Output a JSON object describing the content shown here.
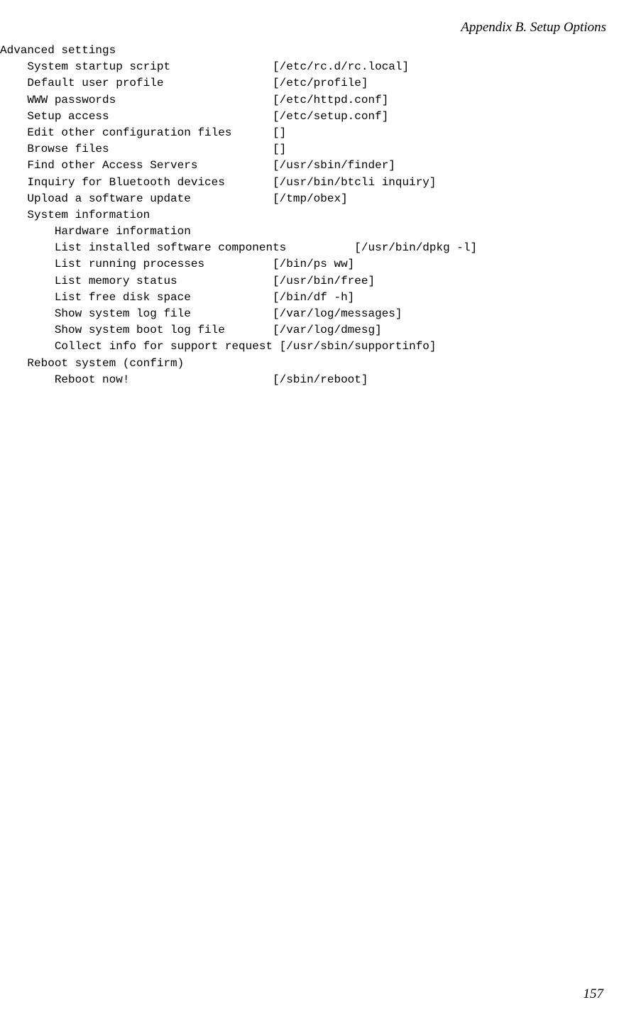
{
  "header": "Appendix B. Setup Options",
  "page_number": "157",
  "lines": [
    {
      "indent": 0,
      "label": "Advanced settings",
      "value": ""
    },
    {
      "indent": 1,
      "label": "System startup script",
      "value": "[/etc/rc.d/rc.local]"
    },
    {
      "indent": 1,
      "label": "Default user profile",
      "value": "[/etc/profile]"
    },
    {
      "indent": 1,
      "label": "WWW passwords",
      "value": "[/etc/httpd.conf]"
    },
    {
      "indent": 1,
      "label": "Setup access",
      "value": "[/etc/setup.conf]"
    },
    {
      "indent": 1,
      "label": "Edit other configuration files",
      "value": "[]"
    },
    {
      "indent": 1,
      "label": "Browse files",
      "value": "[]"
    },
    {
      "indent": 1,
      "label": "Find other Access Servers",
      "value": "[/usr/sbin/finder]"
    },
    {
      "indent": 1,
      "label": "Inquiry for Bluetooth devices",
      "value": "[/usr/bin/btcli inquiry]"
    },
    {
      "indent": 1,
      "label": "Upload a software update",
      "value": "[/tmp/obex]"
    },
    {
      "indent": 1,
      "label": "System information",
      "value": ""
    },
    {
      "indent": 2,
      "label": "Hardware information",
      "value": ""
    },
    {
      "indent": 2,
      "label": "List installed software components",
      "value": "[/usr/bin/dpkg -l]",
      "label_width": 44
    },
    {
      "indent": 2,
      "label": "List running processes",
      "value": "[/bin/ps ww]"
    },
    {
      "indent": 2,
      "label": "List memory status",
      "value": "[/usr/bin/free]"
    },
    {
      "indent": 2,
      "label": "List free disk space",
      "value": "[/bin/df -h]"
    },
    {
      "indent": 2,
      "label": "Show system log file",
      "value": "[/var/log/messages]"
    },
    {
      "indent": 2,
      "label": "Show system boot log file",
      "value": "[/var/log/dmesg]"
    },
    {
      "indent": 2,
      "label": "Collect info for support request",
      "value": "[/usr/sbin/supportinfo]"
    },
    {
      "indent": 1,
      "label": "Reboot system (confirm)",
      "value": ""
    },
    {
      "indent": 2,
      "label": "Reboot now!",
      "value": "[/sbin/reboot]"
    }
  ]
}
